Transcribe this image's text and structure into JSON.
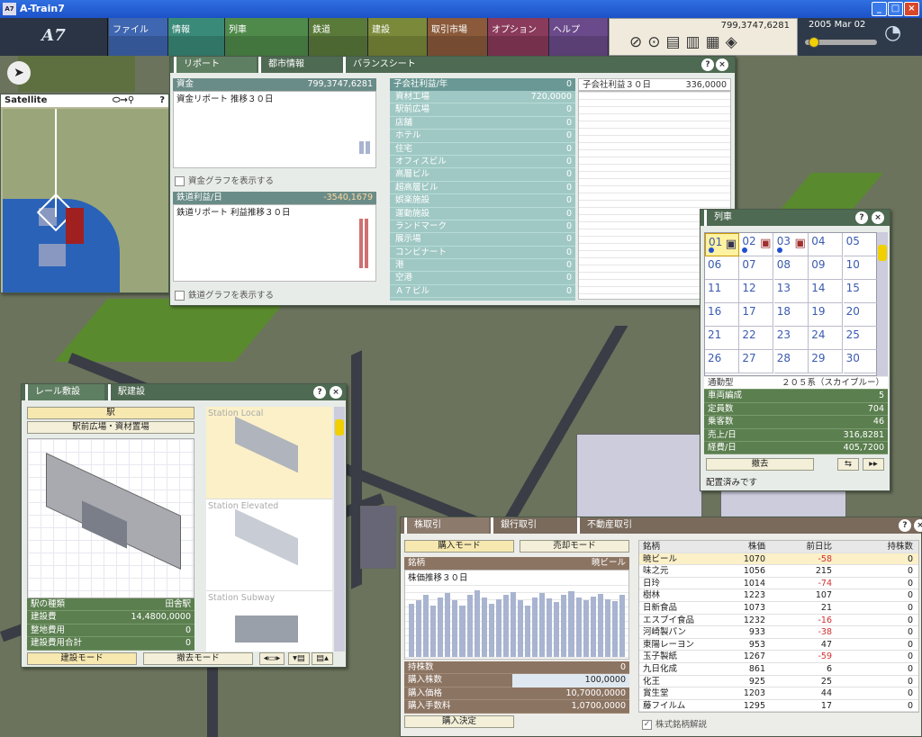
{
  "titlebar": {
    "title": "A-Train7",
    "logo": "A7"
  },
  "topbar": {
    "logo": "A7",
    "menus": [
      {
        "label": "ファイル",
        "color": "#3f66b0"
      },
      {
        "label": "情報",
        "color": "#3a8a7a"
      },
      {
        "label": "列車",
        "color": "#4f8a4a"
      },
      {
        "label": "鉄道",
        "color": "#5a7a3a"
      },
      {
        "label": "建設",
        "color": "#7a8a3a"
      },
      {
        "label": "取引市場",
        "color": "#8a5a3a"
      },
      {
        "label": "オプション",
        "color": "#8a3a5a"
      },
      {
        "label": "ヘルプ",
        "color": "#6a4a8a"
      }
    ],
    "money": "799,3747,6281",
    "date": "2005 Mar 02"
  },
  "satellite": {
    "title": "Satellite",
    "help": "?"
  },
  "report": {
    "tabs": [
      "リポート",
      "都市情報",
      "バランスシート"
    ],
    "funds_label": "資金",
    "funds_value": "799,3747,6281",
    "funds_sub": "資金リポート 推移３０日",
    "funds_chk": "資金グラフを表示する",
    "rail_label": "鉄道利益/日",
    "rail_value": "-3540,1679",
    "rail_sub": "鉄道リポート 利益推移３０日",
    "rail_chk": "鉄道グラフを表示する",
    "sub_header": "子会社利益/年",
    "sub_header_value": "0",
    "sub_rows": [
      {
        "name": "資材工場",
        "value": "720,0000"
      },
      {
        "name": "駅前広場",
        "value": "0"
      },
      {
        "name": "店舗",
        "value": "0"
      },
      {
        "name": "ホテル",
        "value": "0"
      },
      {
        "name": "住宅",
        "value": "0"
      },
      {
        "name": "オフィスビル",
        "value": "0"
      },
      {
        "name": "高層ビル",
        "value": "0"
      },
      {
        "name": "超高層ビル",
        "value": "0"
      },
      {
        "name": "娯楽施設",
        "value": "0"
      },
      {
        "name": "運動施設",
        "value": "0"
      },
      {
        "name": "ランドマーク",
        "value": "0"
      },
      {
        "name": "展示場",
        "value": "0"
      },
      {
        "name": "コンビナート",
        "value": "0"
      },
      {
        "name": "港",
        "value": "0"
      },
      {
        "name": "空港",
        "value": "0"
      },
      {
        "name": "Ａ７ビル",
        "value": "0"
      }
    ],
    "sub30_label": "子会社利益３０日",
    "sub30_value": "336,0000"
  },
  "trains": {
    "title": "列車",
    "numbers": [
      "01",
      "02",
      "03",
      "04",
      "05",
      "06",
      "07",
      "08",
      "09",
      "10",
      "11",
      "12",
      "13",
      "14",
      "15",
      "16",
      "17",
      "18",
      "19",
      "20",
      "21",
      "22",
      "23",
      "24",
      "25",
      "26",
      "27",
      "28",
      "29",
      "30"
    ],
    "type_label": "通勤型",
    "type_value": "２０５系（スカイブルー）",
    "info": [
      {
        "name": "車両編成",
        "value": "5"
      },
      {
        "name": "定員数",
        "value": "704"
      },
      {
        "name": "乗客数",
        "value": "46"
      },
      {
        "name": "売上/日",
        "value": "316,8281"
      },
      {
        "name": "経費/日",
        "value": "405,7200"
      }
    ],
    "remove": "撤去",
    "status": "配置済みです"
  },
  "rail": {
    "tabs": [
      "レール敷設",
      "駅建設"
    ],
    "cat": "駅",
    "subcat": "駅前広場・資材置場",
    "stations": [
      "Station Local",
      "Station Elevated",
      "Station Subway"
    ],
    "kind_label": "駅の種類",
    "kind_value": "田舎駅",
    "rows": [
      {
        "name": "建設費",
        "value": "14,4800,0000"
      },
      {
        "name": "整地費用",
        "value": "0"
      },
      {
        "name": "建設費用合計",
        "value": "0"
      }
    ],
    "build_mode": "建設モード",
    "remove_mode": "撤去モード"
  },
  "stock": {
    "tabs": [
      "株取引",
      "銀行取引",
      "不動産取引"
    ],
    "buy_mode": "購入モード",
    "sell_mode": "売却モード",
    "brand_label": "銘柄",
    "brand_value": "暁ビール",
    "chart_title": "株価推移３０日",
    "chart_data": {
      "type": "bar",
      "values": [
        52,
        55,
        60,
        50,
        58,
        62,
        55,
        50,
        60,
        65,
        58,
        52,
        56,
        60,
        63,
        55,
        50,
        58,
        62,
        57,
        53,
        60,
        64,
        58,
        55,
        59,
        61,
        56,
        54,
        60
      ]
    },
    "held_label": "持株数",
    "held_value": "0",
    "qty_label": "購入株数",
    "qty_value": "100,0000",
    "price_label": "購入価格",
    "price_value": "10,7000,0000",
    "fee_label": "購入手数料",
    "fee_value": "1,0700,0000",
    "confirm": "購入決定",
    "cols": [
      "銘柄",
      "株価",
      "前日比",
      "持株数"
    ],
    "rows": [
      {
        "name": "暁ビール",
        "price": "1070",
        "diff": "-58",
        "held": "0"
      },
      {
        "name": "味之元",
        "price": "1056",
        "diff": "215",
        "held": "0"
      },
      {
        "name": "日玲",
        "price": "1014",
        "diff": "-74",
        "held": "0"
      },
      {
        "name": "樹林",
        "price": "1223",
        "diff": "107",
        "held": "0"
      },
      {
        "name": "日新食品",
        "price": "1073",
        "diff": "21",
        "held": "0"
      },
      {
        "name": "エスブイ食品",
        "price": "1232",
        "diff": "-16",
        "held": "0"
      },
      {
        "name": "河崎製パン",
        "price": "933",
        "diff": "-38",
        "held": "0"
      },
      {
        "name": "東陽レーヨン",
        "price": "953",
        "diff": "47",
        "held": "0"
      },
      {
        "name": "玉子製紙",
        "price": "1267",
        "diff": "-59",
        "held": "0"
      },
      {
        "name": "九日化成",
        "price": "861",
        "diff": "6",
        "held": "0"
      },
      {
        "name": "化王",
        "price": "925",
        "diff": "25",
        "held": "0"
      },
      {
        "name": "賞生堂",
        "price": "1203",
        "diff": "44",
        "held": "0"
      },
      {
        "name": "藤フイルム",
        "price": "1295",
        "diff": "17",
        "held": "0"
      }
    ],
    "explain": "株式銘柄解説"
  }
}
